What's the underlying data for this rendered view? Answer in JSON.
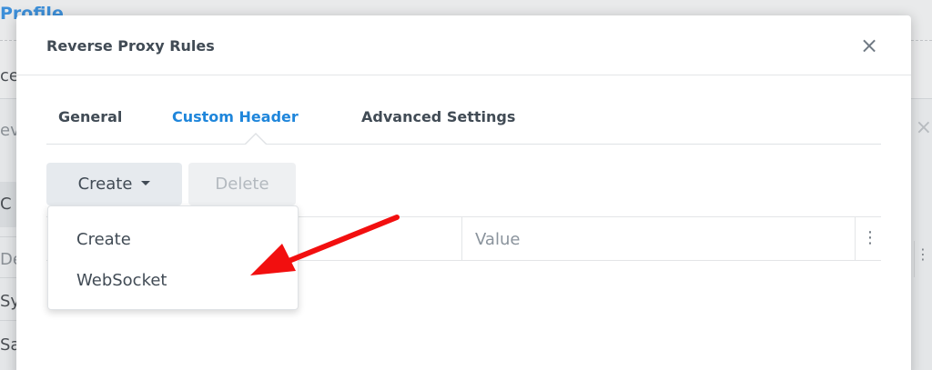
{
  "background": {
    "profile_fragment": "Profile",
    "fragments": [
      "ce",
      "ev",
      "C",
      "De",
      "Sy",
      "Sa"
    ],
    "close_glyph": "×",
    "menu_glyph": "⋮"
  },
  "modal": {
    "title": "Reverse Proxy Rules",
    "close_glyph": "×"
  },
  "tabs": [
    {
      "label": "General",
      "active": false
    },
    {
      "label": "Custom Header",
      "active": true
    },
    {
      "label": "Advanced Settings",
      "active": false
    }
  ],
  "toolbar": {
    "create_label": "Create",
    "delete_label": "Delete"
  },
  "grid": {
    "columns": [
      "",
      "Value"
    ],
    "menu_glyph": "⋮"
  },
  "dropdown": {
    "items": [
      "Create",
      "WebSocket"
    ]
  },
  "colors": {
    "accent": "#1f86db",
    "annotation_arrow": "#f20f0f",
    "text": "#414b55"
  },
  "icons": {
    "close": "close-icon",
    "caret": "caret-down-icon",
    "column_menu": "vertical-dots-icon",
    "annotation": "red-arrow-annotation"
  }
}
